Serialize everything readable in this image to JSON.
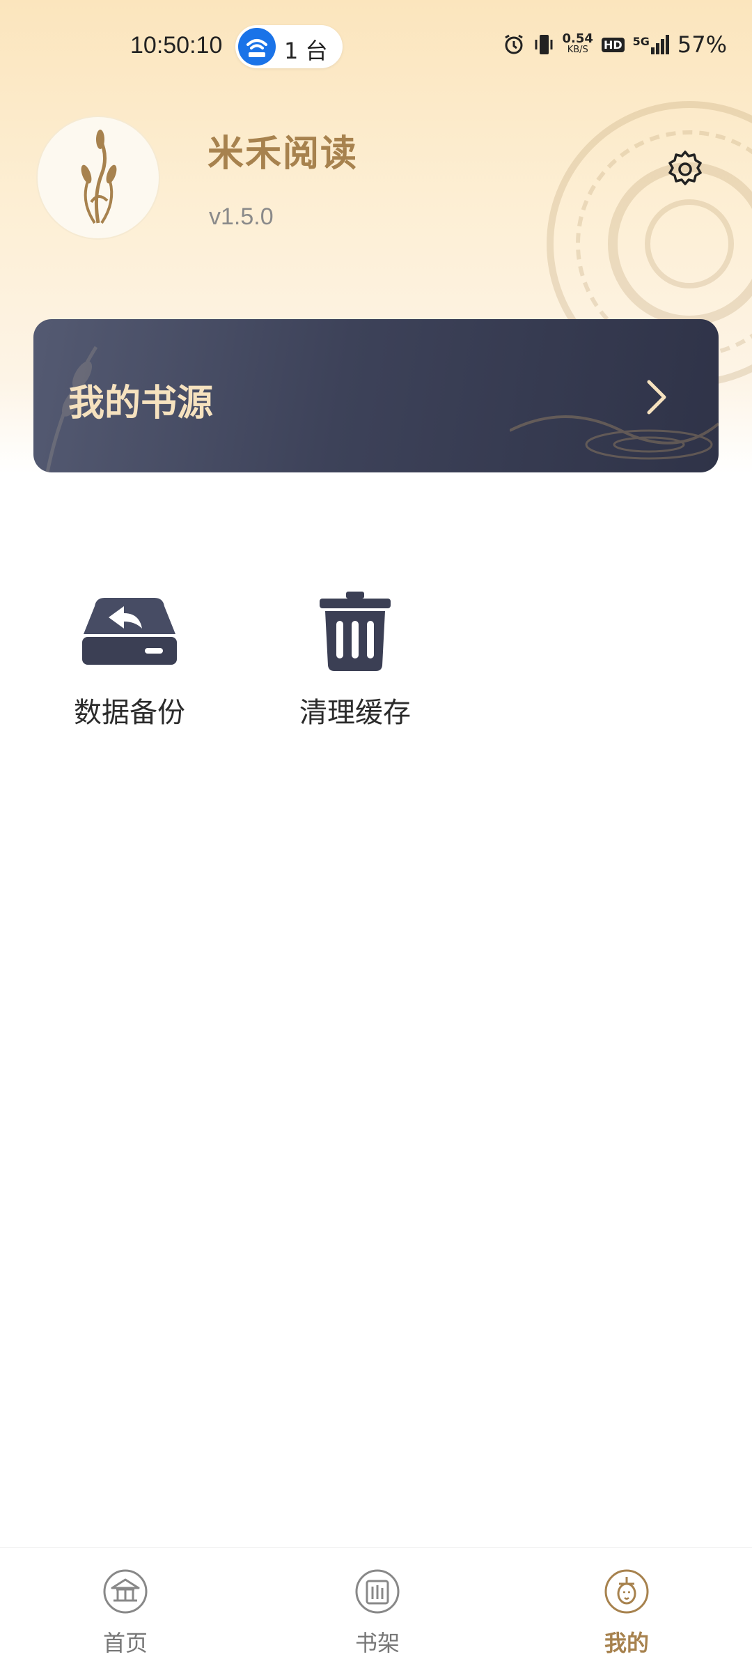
{
  "status_bar": {
    "time": "10:50:10",
    "hotspot_count": "1 台",
    "network_speed_value": "0.54",
    "network_speed_unit": "KB/S",
    "hd": "HD",
    "signal_type": "5G",
    "battery": "57%"
  },
  "header": {
    "app_name": "米禾阅读",
    "version": "v1.5.0"
  },
  "banner": {
    "title": "我的书源"
  },
  "tools": [
    {
      "label": "数据备份",
      "icon": "backup-drive-icon"
    },
    {
      "label": "清理缓存",
      "icon": "trash-icon"
    }
  ],
  "tabbar": [
    {
      "label": "首页",
      "icon": "home-temple-icon",
      "active": false
    },
    {
      "label": "书架",
      "icon": "bookshelf-icon",
      "active": false
    },
    {
      "label": "我的",
      "icon": "profile-avatar-icon",
      "active": true
    }
  ],
  "colors": {
    "accent": "#a7824e",
    "banner": "#3d4259",
    "icon_dark": "#3b3f54"
  }
}
